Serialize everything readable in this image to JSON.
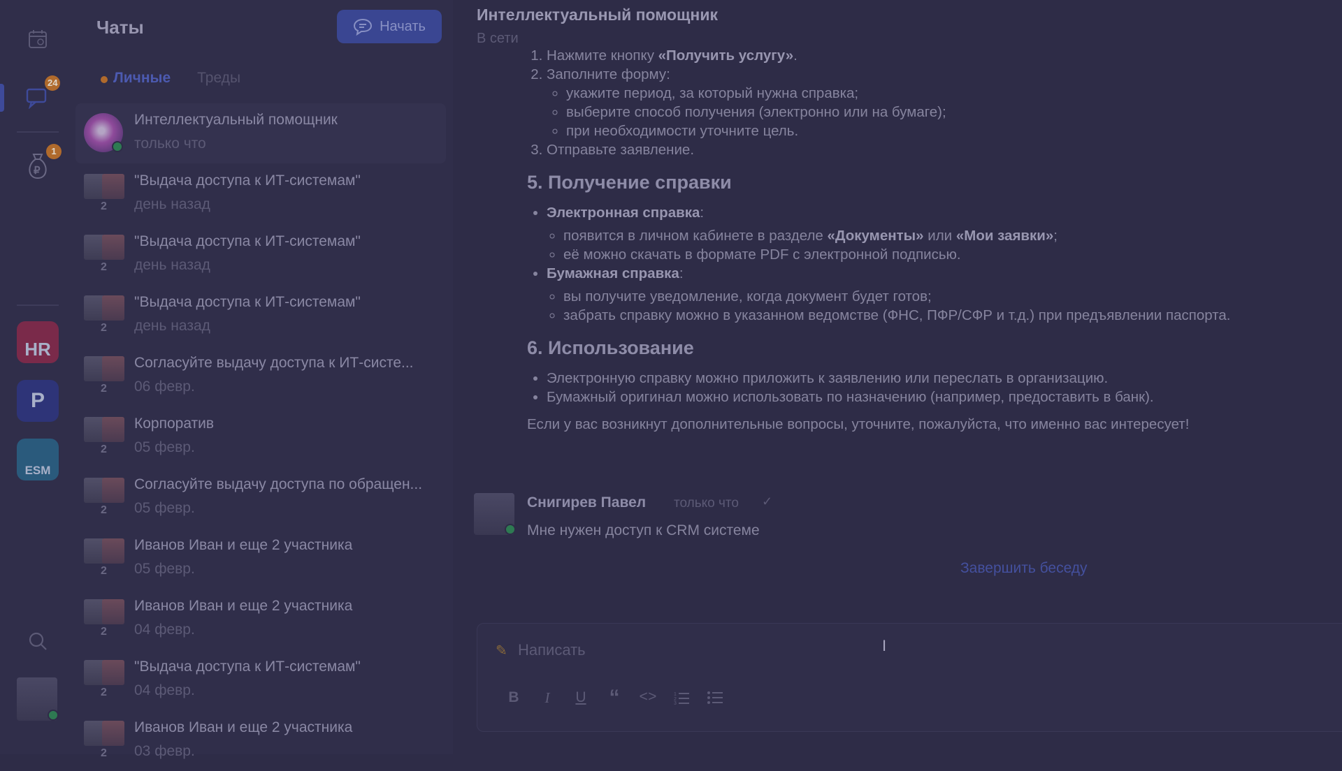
{
  "rail": {
    "chat_badge": "24",
    "finance_badge": "1",
    "apps": [
      {
        "label": "HR",
        "color": "#b0385a"
      },
      {
        "label": "P",
        "color": "#3a48b4"
      },
      {
        "label": "ESM",
        "color": "#2a7ab0"
      }
    ]
  },
  "chat_list": {
    "title": "Чаты",
    "start_label": "Начать",
    "tabs": [
      {
        "label": "Личные",
        "active": true
      },
      {
        "label": "Треды",
        "active": false
      }
    ],
    "items": [
      {
        "name": "Интеллектуальный помощник",
        "time": "только что",
        "count": "",
        "selected": true
      },
      {
        "name": "\"Выдача доступа к ИТ-системам\"",
        "time": "день назад",
        "count": "2"
      },
      {
        "name": "\"Выдача доступа к ИТ-системам\"",
        "time": "день назад",
        "count": "2"
      },
      {
        "name": "\"Выдача доступа к ИТ-системам\"",
        "time": "день назад",
        "count": "2"
      },
      {
        "name": "Согласуйте выдачу доступа к ИТ-систе...",
        "time": "06 февр.",
        "count": "2"
      },
      {
        "name": "Корпоратив",
        "time": "05 февр.",
        "count": "2"
      },
      {
        "name": "Согласуйте выдачу доступа по обращен...",
        "time": "05 февр.",
        "count": "2"
      },
      {
        "name": "Иванов Иван и еще 2 участника",
        "time": "05 февр.",
        "count": "2"
      },
      {
        "name": "Иванов Иван и еще 2 участника",
        "time": "04 февр.",
        "count": "2"
      },
      {
        "name": "\"Выдача доступа к ИТ-системам\"",
        "time": "04 февр.",
        "count": "2"
      },
      {
        "name": "Иванов Иван и еще 2 участника",
        "time": "03 февр.",
        "count": "2"
      }
    ]
  },
  "conversation": {
    "title": "Интеллектуальный помощник",
    "status": "В сети",
    "steps": {
      "s1_prefix": "Нажмите кнопку ",
      "s1_bold": "«Получить услугу»",
      "s1_suffix": ".",
      "s2": "Заполните форму:",
      "s2_sub": [
        "укажите период, за который нужна справка;",
        "выберите способ получения (электронно или на бумаге);",
        "при необходимости уточните цель."
      ],
      "s3": "Отправьте заявление."
    },
    "section5": {
      "heading": "5. Получение справки",
      "electronic_label": "Электронная справка",
      "electronic_items": {
        "i1_prefix": "появится в личном кабинете в разделе ",
        "i1_bold1": "«Документы»",
        "i1_mid": " или ",
        "i1_bold2": "«Мои заявки»",
        "i1_suffix": ";",
        "i2": "её можно скачать в формате PDF с электронной подписью."
      },
      "paper_label": "Бумажная справка",
      "paper_items": [
        "вы получите уведомление, когда документ будет готов;",
        "забрать справку можно в указанном ведомстве (ФНС, ПФР/СФР и т.д.) при предъявлении паспорта."
      ]
    },
    "section6": {
      "heading": "6. Использование",
      "items": [
        "Электронную справку можно приложить к заявлению или переслать в организацию.",
        "Бумажный оригинал можно использовать по назначению (например, предоставить в банк)."
      ],
      "closing": "Если у вас возникнут дополнительные вопросы, уточните, пожалуйста, что именно вас интересует!"
    },
    "user_message": {
      "author": "Снигирев Павел",
      "time": "только что",
      "text": "Мне нужен доступ к CRM системе"
    },
    "end_label": "Завершить беседу",
    "composer_placeholder": "Написать"
  }
}
